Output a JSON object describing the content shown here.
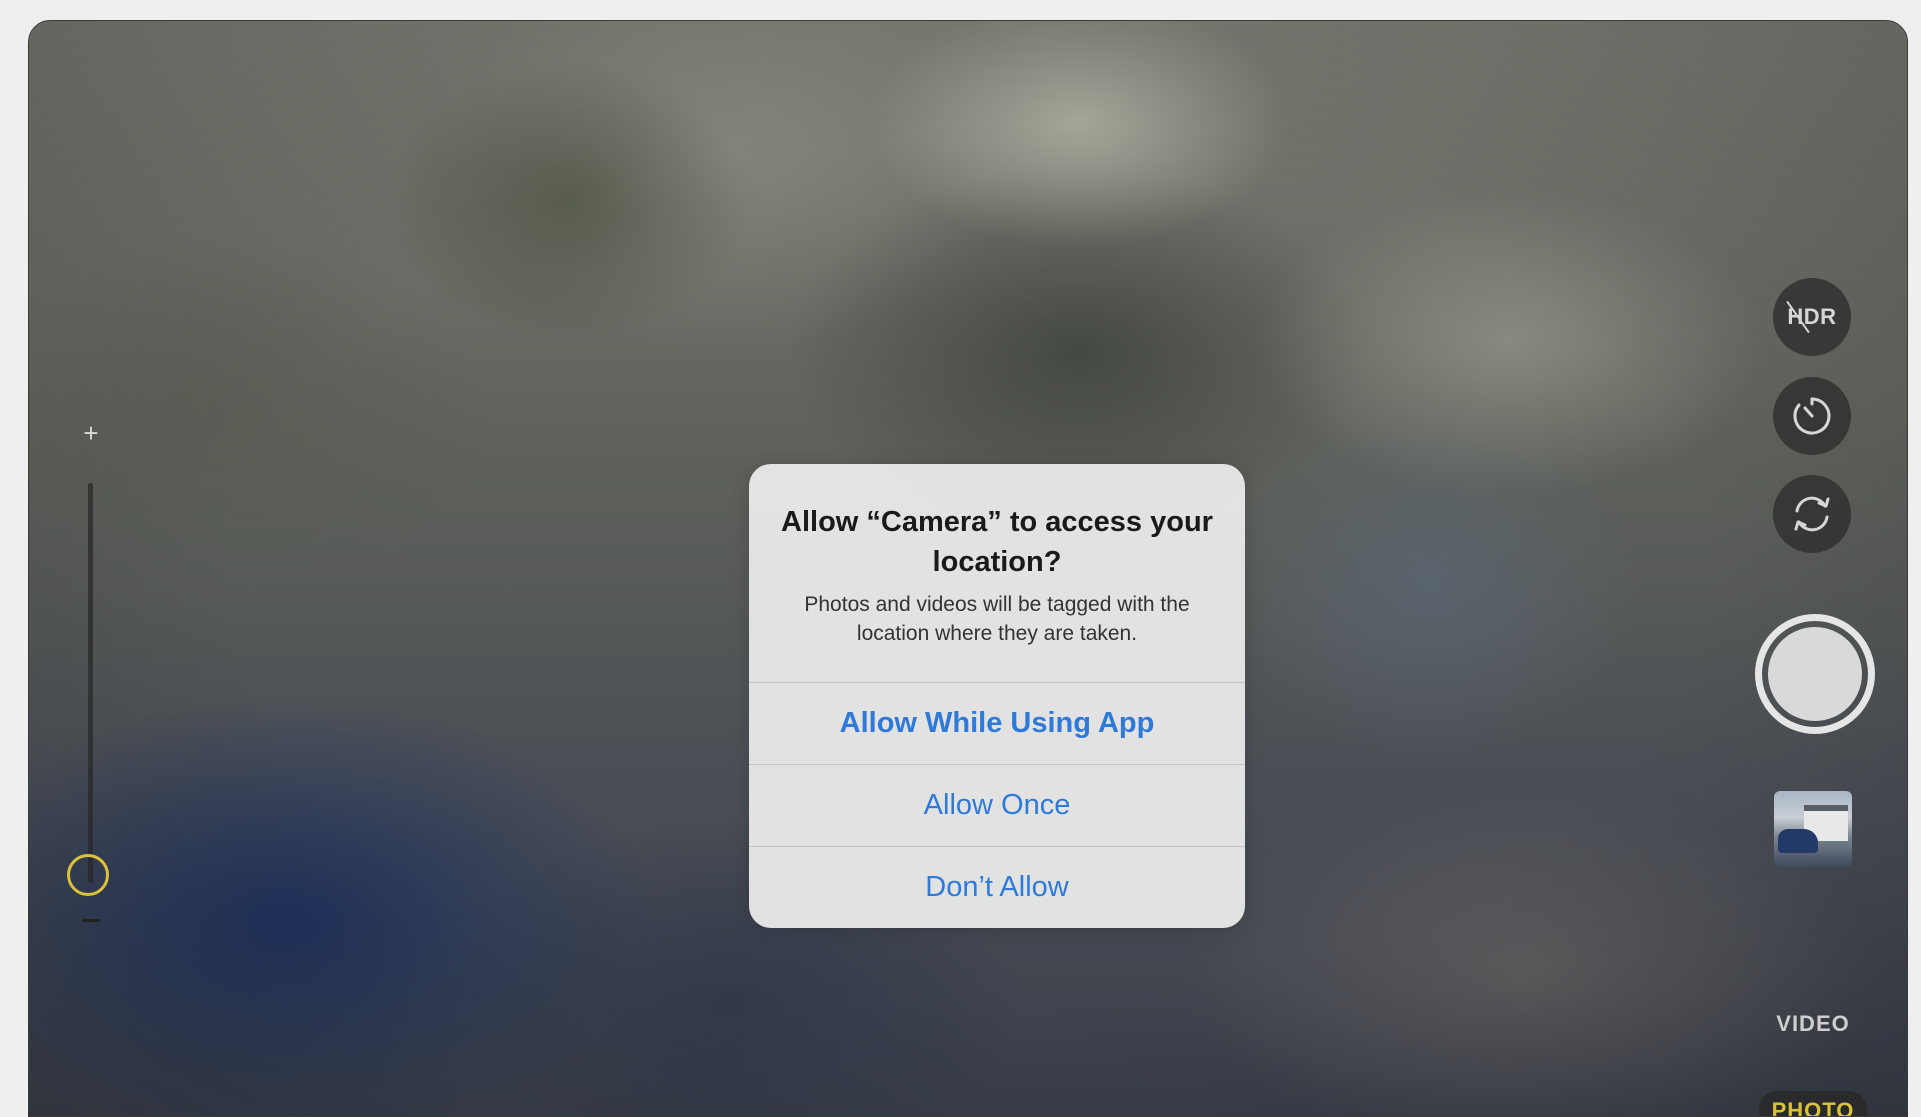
{
  "zoom": {
    "plus_label": "+"
  },
  "controls": {
    "hdr_label": "HDR",
    "modes": [
      "VIDEO",
      "PHOTO"
    ]
  },
  "alert": {
    "title": "Allow “Camera” to access your location?",
    "message": "Photos and videos will be tagged with the location where they are taken.",
    "buttons": [
      "Allow While Using App",
      "Allow Once",
      "Don’t Allow"
    ]
  },
  "colors": {
    "accent_blue": "#2f7ad8",
    "zoom_yellow": "#d9c23a"
  }
}
